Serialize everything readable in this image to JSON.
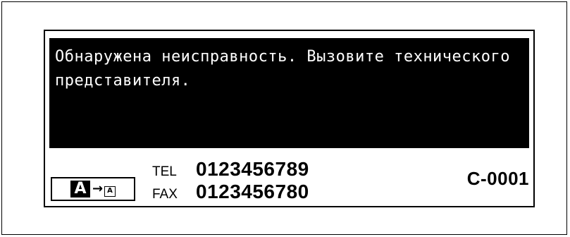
{
  "message": {
    "text": "Обнаружена неисправность. Вызовите технического представителя."
  },
  "language_button": {
    "from_glyph": "A",
    "arrow_glyph": "→",
    "to_glyph": "A"
  },
  "contact": {
    "tel_label": "TEL",
    "tel_number": "0123456789",
    "fax_label": "FAX",
    "fax_number": "0123456780"
  },
  "error_code": "C-0001"
}
